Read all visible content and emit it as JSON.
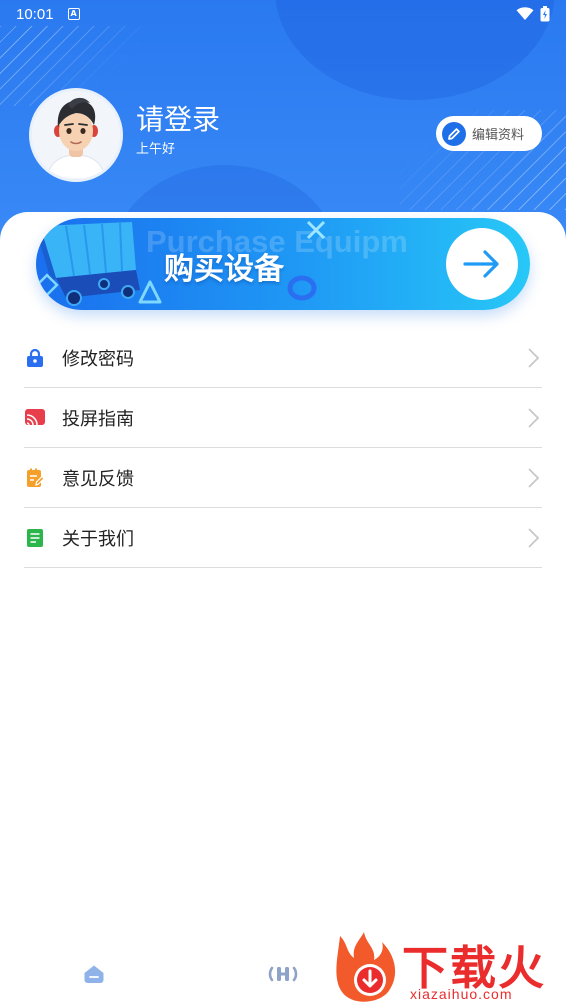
{
  "status_bar": {
    "time": "10:01",
    "app_icon_letter": "A",
    "icons": [
      "wifi-icon",
      "battery-icon"
    ]
  },
  "profile": {
    "title": "请登录",
    "greeting": "上午好",
    "avatar": "avatar-3d-boy",
    "edit_button": "编辑资料"
  },
  "banner": {
    "title": "购买设备",
    "watermark": "Purchase Equipm",
    "arrow_icon": "arrow-right-icon"
  },
  "menu": {
    "items": [
      {
        "label": "修改密码",
        "icon": "lock-icon",
        "color": "#2a6ff0"
      },
      {
        "label": "投屏指南",
        "icon": "cast-icon",
        "color": "#e83e4c"
      },
      {
        "label": "意见反馈",
        "icon": "feedback-icon",
        "color": "#f5a02a"
      },
      {
        "label": "关于我们",
        "icon": "document-icon",
        "color": "#2bb54a"
      }
    ]
  },
  "bottom_nav": {
    "tabs": [
      {
        "icon": "home-icon"
      },
      {
        "icon": "device-icon"
      }
    ]
  },
  "watermark": {
    "text": "下载火",
    "url": "xiazaihuo.com"
  },
  "colors": {
    "header_blue": "#2a79f0",
    "accent_red": "#ea2c2c"
  }
}
